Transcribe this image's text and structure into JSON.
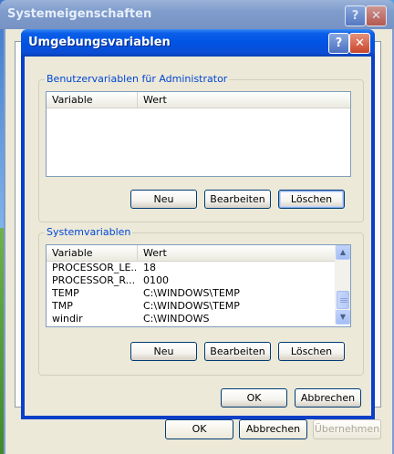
{
  "outer_window": {
    "title": "Systemeigenschaften",
    "buttons": {
      "ok": "OK",
      "cancel": "Abbrechen",
      "apply": "Übernehmen"
    }
  },
  "dialog": {
    "title": "Umgebungsvariablen",
    "user_group": {
      "label": "Benutzervariablen für Administrator",
      "columns": [
        "Variable",
        "Wert"
      ],
      "rows": [],
      "buttons": {
        "new": "Neu",
        "edit": "Bearbeiten",
        "delete": "Löschen"
      }
    },
    "system_group": {
      "label": "Systemvariablen",
      "columns": [
        "Variable",
        "Wert"
      ],
      "rows": [
        {
          "variable": "PROCESSOR_LE...",
          "value": "18"
        },
        {
          "variable": "PROCESSOR_R...",
          "value": "0100"
        },
        {
          "variable": "TEMP",
          "value": "C:\\WINDOWS\\TEMP"
        },
        {
          "variable": "TMP",
          "value": "C:\\WINDOWS\\TEMP"
        },
        {
          "variable": "windir",
          "value": "C:\\WINDOWS"
        }
      ],
      "buttons": {
        "new": "Neu",
        "edit": "Bearbeiten",
        "delete": "Löschen"
      }
    },
    "buttons": {
      "ok": "OK",
      "cancel": "Abbrechen"
    }
  },
  "icons": {
    "help": "help-icon",
    "close": "close-icon",
    "scroll_up": "scroll-up-icon",
    "scroll_down": "scroll-down-icon"
  }
}
